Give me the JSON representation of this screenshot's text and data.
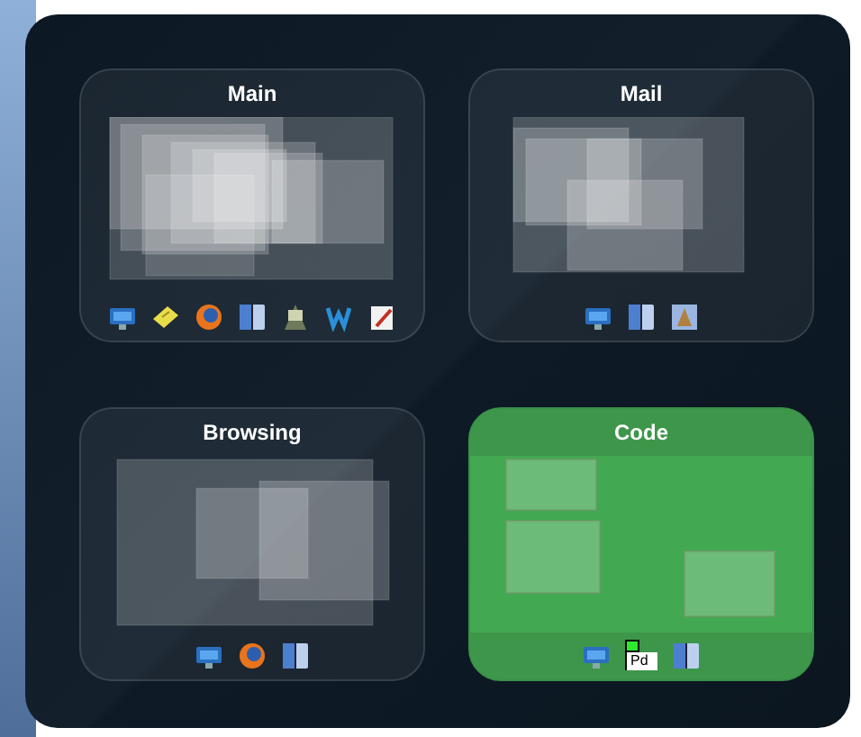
{
  "spaces": [
    {
      "title": "Main",
      "selected": false,
      "apps": [
        {
          "kind": "network"
        },
        {
          "kind": "notes"
        },
        {
          "kind": "browser"
        },
        {
          "kind": "finder"
        },
        {
          "kind": "graphic"
        },
        {
          "kind": "editor"
        },
        {
          "kind": "document"
        }
      ]
    },
    {
      "title": "Mail",
      "selected": false,
      "apps": [
        {
          "kind": "network"
        },
        {
          "kind": "finder"
        },
        {
          "kind": "preview"
        }
      ]
    },
    {
      "title": "Browsing",
      "selected": false,
      "apps": [
        {
          "kind": "network"
        },
        {
          "kind": "browser"
        },
        {
          "kind": "finder"
        }
      ]
    },
    {
      "title": "Code",
      "selected": true,
      "apps": [
        {
          "kind": "network"
        },
        {
          "kind": "pd",
          "label": "Pd"
        },
        {
          "kind": "finder"
        }
      ]
    }
  ]
}
